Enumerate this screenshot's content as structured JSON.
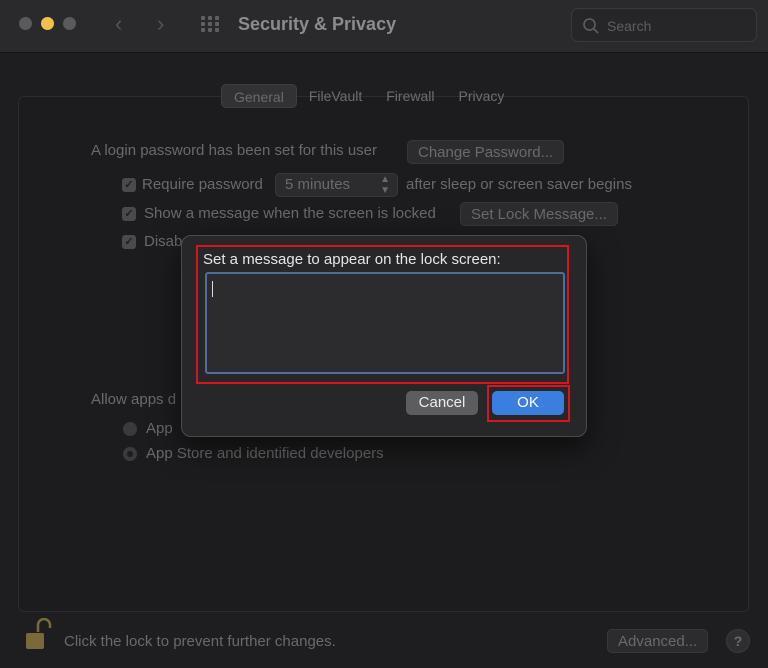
{
  "window": {
    "title": "Security & Privacy"
  },
  "search": {
    "placeholder": "Search"
  },
  "tabs": [
    {
      "label": "General",
      "selected": true
    },
    {
      "label": "FileVault",
      "selected": false
    },
    {
      "label": "Firewall",
      "selected": false
    },
    {
      "label": "Privacy",
      "selected": false
    }
  ],
  "general": {
    "login_text": "A login password has been set for this user",
    "change_password_label": "Change Password...",
    "require_password_label": "Require password",
    "require_password_value": "5 minutes",
    "after_sleep_text": "after sleep or screen saver begins",
    "show_message_label": "Show a message when the screen is locked",
    "set_lock_message_label": "Set Lock Message...",
    "disable_label_partial": "Disab",
    "allow_apps_partial": "Allow apps d",
    "app_store_partial": "App",
    "app_store_identified_label": "App Store and identified developers"
  },
  "footer": {
    "lock_text": "Click the lock to prevent further changes.",
    "advanced_label": "Advanced...",
    "help_label": "?"
  },
  "dialog": {
    "prompt": "Set a message to appear on the lock screen:",
    "message_value": "",
    "cancel_label": "Cancel",
    "ok_label": "OK"
  },
  "colors": {
    "accent": "#3a7fe0",
    "highlight": "#d8141e"
  }
}
